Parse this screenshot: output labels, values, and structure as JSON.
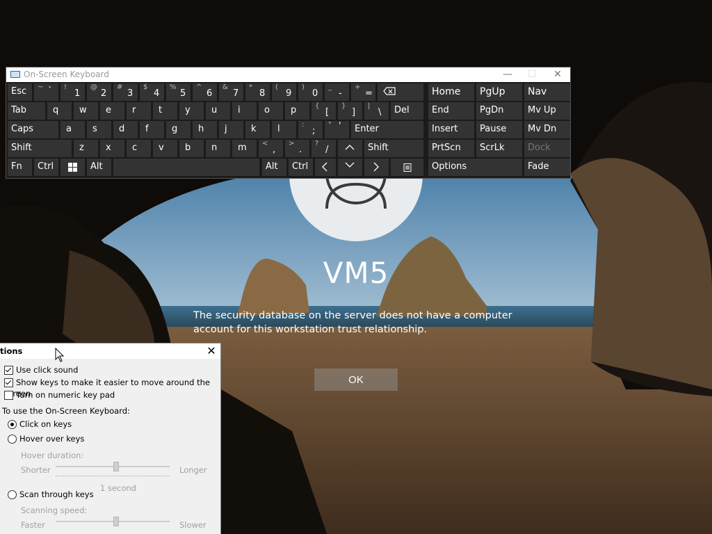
{
  "lock_screen": {
    "username": "VM5",
    "message": "The security database on the server does not have a computer account for this workstation trust relationship.",
    "ok_label": "OK"
  },
  "osk": {
    "title": "On-Screen Keyboard",
    "window_buttons": {
      "minimize": "—",
      "maximize": "☐",
      "close": "✕"
    },
    "row1": {
      "esc": "Esc",
      "k1s": "~",
      "k1": "`",
      "k2s": "!",
      "k2": "1",
      "k3s": "@",
      "k3": "2",
      "k4s": "#",
      "k4": "3",
      "k5s": "$",
      "k5": "4",
      "k6s": "%",
      "k6": "5",
      "k7s": "^",
      "k7": "6",
      "k8s": "&",
      "k8": "7",
      "k9s": "*",
      "k9": "8",
      "k10s": "(",
      "k10": "9",
      "k11s": ")",
      "k11": "0",
      "k12s": "_",
      "k12": "-",
      "k13s": "+",
      "k13": "="
    },
    "row2": {
      "tab": "Tab",
      "q": "q",
      "w": "w",
      "e": "e",
      "r": "r",
      "t": "t",
      "y": "y",
      "u": "u",
      "i": "i",
      "o": "o",
      "p": "p",
      "lbs": "{",
      "lb": "[",
      "rbs": "}",
      "rb": "]",
      "bss": "|",
      "bs": "\\",
      "del": "Del"
    },
    "row3": {
      "caps": "Caps",
      "a": "a",
      "s": "s",
      "d": "d",
      "f": "f",
      "g": "g",
      "h": "h",
      "j": "j",
      "k": "k",
      "l": "l",
      "scs": ":",
      "sc": ";",
      "qts": "\"",
      "qt": "'",
      "enter": "Enter"
    },
    "row4": {
      "shift": "Shift",
      "z": "z",
      "x": "x",
      "c": "c",
      "v": "v",
      "b": "b",
      "n": "n",
      "m": "m",
      "cms": "<",
      "cm": ",",
      "pds": ">",
      "pd": ".",
      "sls": "?",
      "sl": "/",
      "shift2": "Shift"
    },
    "row5": {
      "fn": "Fn",
      "ctrl": "Ctrl",
      "alt": "Alt",
      "alt2": "Alt",
      "ctrl2": "Ctrl"
    },
    "nav": {
      "home": "Home",
      "pgup": "PgUp",
      "nav": "Nav",
      "end": "End",
      "pgdn": "PgDn",
      "mvup": "Mv Up",
      "insert": "Insert",
      "pause": "Pause",
      "mvdn": "Mv Dn",
      "prtscn": "PrtScn",
      "scrlk": "ScrLk",
      "dock": "Dock",
      "options": "Options",
      "fade": "Fade"
    }
  },
  "options": {
    "title": "tions",
    "close": "✕",
    "use_click_sound": "Use click sound",
    "show_keys": "Show keys to make it easier to move around the screen",
    "numeric_pad": "Turn on numeric key pad",
    "use_osk_label": "To use the On-Screen Keyboard:",
    "click_on_keys": "Click on keys",
    "hover_over_keys": "Hover over keys",
    "hover_duration": "Hover duration:",
    "shorter": "Shorter",
    "longer": "Longer",
    "one_second": "1 second",
    "scan_through_keys": "Scan through keys",
    "scanning_speed": "Scanning speed:",
    "faster": "Faster",
    "slower": "Slower",
    "checked": {
      "click_sound": true,
      "show_keys": true,
      "numeric_pad": false
    },
    "selected_mode": "click_on_keys",
    "hover_level": 0.53,
    "scan_level": 0.53
  },
  "colors": {
    "osk_bg": "#1b1b1b",
    "key_bg": "#333333",
    "dialog_bg": "#f0f0f0"
  }
}
